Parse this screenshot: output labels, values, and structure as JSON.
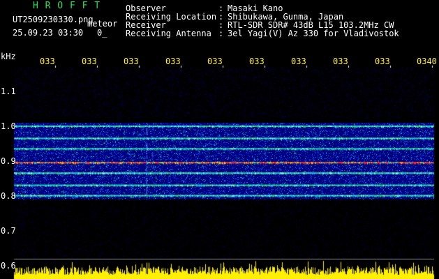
{
  "header": {
    "brand": "H R O F F T",
    "file_name": "UT2509230330.png",
    "mode_label": "meteor",
    "date_time": "25.09.23 03:30",
    "small_value": "0_",
    "fields": [
      {
        "label": "Observer",
        "value": "Masaki Kano"
      },
      {
        "label": "Receiving Location",
        "value": "Shibukawa, Gunma, Japan"
      },
      {
        "label": "Receiver",
        "value": "RTL-SDR SDR# 43dB L15 103.2MHz CW"
      },
      {
        "label": "Receiving Antenna",
        "value": "3el Yagi(V) Az 330 for Vladivostok"
      }
    ]
  },
  "axes": {
    "y_unit": "kHz",
    "y_ticks": [
      "1.1",
      "1.0",
      "0.9",
      "0.8",
      "0.7",
      "0.6"
    ],
    "y_tick_values": [
      1.1,
      1.0,
      0.9,
      0.8,
      0.7,
      0.6
    ],
    "time_ticks": [
      "033",
      "033",
      "033",
      "033",
      "033",
      "033",
      "033",
      "033",
      "033",
      "0340"
    ],
    "y_range": [
      0.6,
      1.2
    ]
  },
  "display": {
    "band_frequencies_khz": [
      1.0,
      0.965,
      0.935,
      0.895,
      0.865,
      0.83,
      0.8
    ],
    "strong_band_khz": 0.895
  },
  "colors": {
    "background": "#000000",
    "axis_text": "#ffffff",
    "brand": "#2ee05a",
    "time_ticks": "#ffef3a",
    "noise_floor": "#000080",
    "signal_low": "#1e5cff",
    "signal_mid": "#18c8d8",
    "signal_high": "#ff2a2a",
    "power_trace": "#ffef00"
  }
}
